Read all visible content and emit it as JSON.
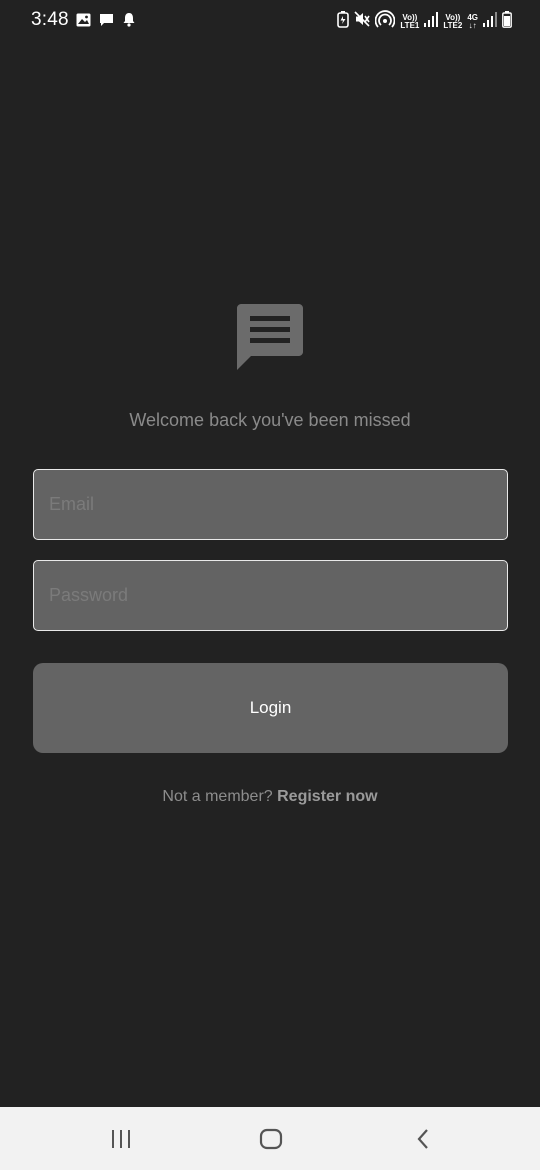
{
  "status_bar": {
    "time": "3:48",
    "left_icons": [
      "gallery-icon",
      "message-icon",
      "notification-bell-icon"
    ],
    "right_icons": [
      "battery-saver-icon",
      "mute-icon",
      "hotspot-icon",
      "volte-lte1-icon",
      "signal-1-icon",
      "volte-lte2-icon",
      "4g-icon",
      "signal-2-icon",
      "battery-icon"
    ],
    "volte1": "Vo))",
    "lte1": "LTE1",
    "volte2": "Vo))",
    "lte2": "LTE2",
    "net_4g": "4G"
  },
  "logo": {
    "icon": "chat-bubble-lines-icon",
    "color": "#6b6b6b"
  },
  "welcome_text": "Welcome back you've been missed",
  "form": {
    "email": {
      "placeholder": "Email",
      "value": ""
    },
    "password": {
      "placeholder": "Password",
      "value": ""
    },
    "login_label": "Login"
  },
  "register": {
    "prompt": "Not a member?",
    "link": "Register now"
  },
  "nav_bar": {
    "buttons": [
      "recent-apps-icon",
      "home-icon",
      "back-icon"
    ]
  },
  "colors": {
    "background": "#222222",
    "field_bg": "#636363",
    "field_border": "#e9e9e9",
    "button_bg": "#646464",
    "nav_bg": "#f2f2f2"
  }
}
